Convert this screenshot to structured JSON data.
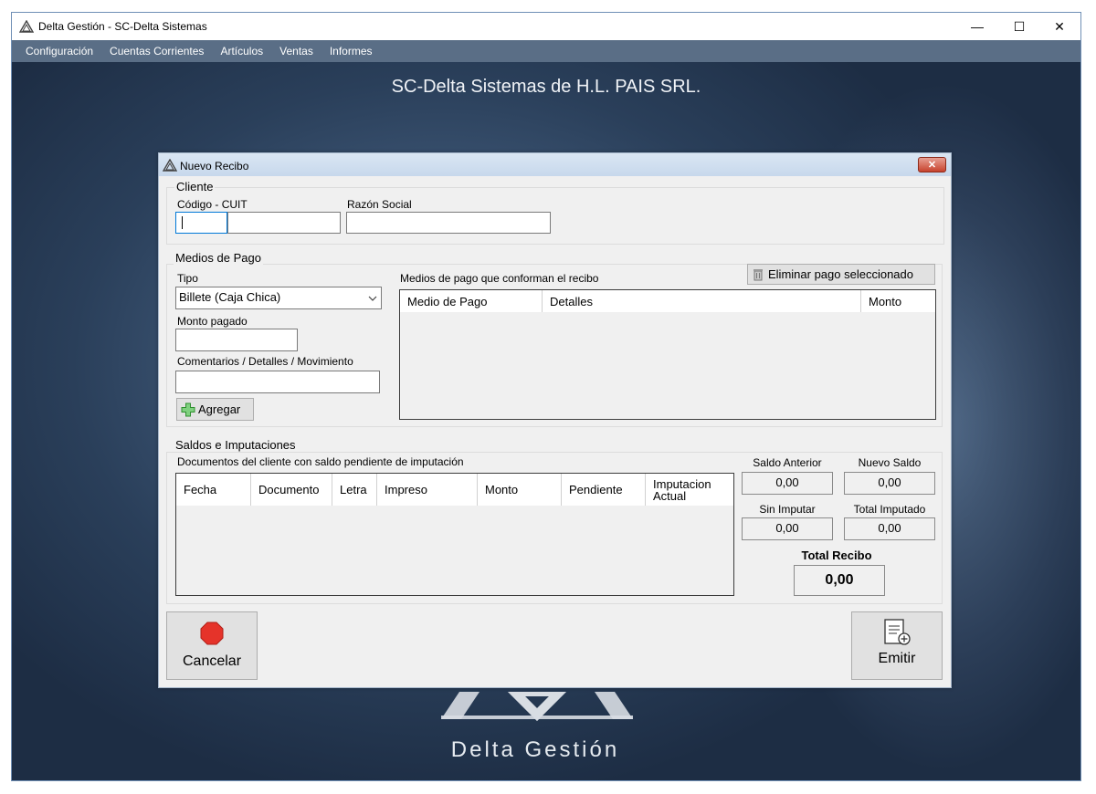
{
  "window": {
    "title": "Delta Gestión - SC-Delta Sistemas",
    "minimize_glyph": "—",
    "maximize_glyph": "☐",
    "close_glyph": "✕"
  },
  "menu": {
    "items": [
      "Configuración",
      "Cuentas Corrientes",
      "Artículos",
      "Ventas",
      "Informes"
    ]
  },
  "desktop": {
    "company_title": "SC-Delta Sistemas de H.L. PAIS SRL.",
    "logo_text": "Delta Gestión"
  },
  "dialog": {
    "title": "Nuevo Recibo",
    "close_glyph": "✕",
    "cliente": {
      "group_label": "Cliente",
      "codigo_label": "Código - CUIT",
      "codigo_value": "",
      "codigo_extra_value": "",
      "razon_label": "Razón Social",
      "razon_value": ""
    },
    "medios_pago": {
      "group_label": "Medios de Pago",
      "tipo_label": "Tipo",
      "tipo_value": "Billete (Caja Chica)",
      "monto_label": "Monto pagado",
      "monto_value": "",
      "comentarios_label": "Comentarios / Detalles / Movimiento",
      "comentarios_value": "",
      "agregar_label": "Agregar",
      "lista_label": "Medios de pago que conforman el recibo",
      "eliminar_label": "Eliminar pago seleccionado",
      "columns": [
        "Medio de Pago",
        "Detalles",
        "Monto"
      ]
    },
    "saldos": {
      "group_label": "Saldos e Imputaciones",
      "docs_label": "Documentos del cliente con saldo pendiente de imputación",
      "columns": [
        "Fecha",
        "Documento",
        "Letra",
        "Impreso",
        "Monto",
        "Pendiente",
        "Imputacion Actual"
      ],
      "saldo_anterior_label": "Saldo Anterior",
      "saldo_anterior_value": "0,00",
      "nuevo_saldo_label": "Nuevo Saldo",
      "nuevo_saldo_value": "0,00",
      "sin_imputar_label": "Sin Imputar",
      "sin_imputar_value": "0,00",
      "total_imputado_label": "Total Imputado",
      "total_imputado_value": "0,00",
      "total_recibo_label": "Total Recibo",
      "total_recibo_value": "0,00"
    },
    "cancelar_label": "Cancelar",
    "emitir_label": "Emitir"
  },
  "colors": {
    "menubar": "#5a6e86",
    "dialog_bg": "#f0f0f0",
    "stop_icon": "#e5332a",
    "plus_icon": "#3aa53a"
  }
}
